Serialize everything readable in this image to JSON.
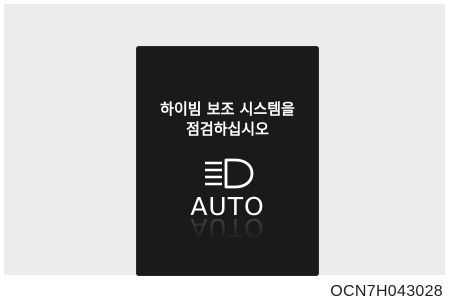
{
  "display": {
    "message_line1": "하이빔 보조 시스템을",
    "message_line2": "점검하십시오",
    "mode_label": "AUTO",
    "icon": "high-beam-headlamp-icon"
  },
  "figure_code": "OCN7H043028",
  "colors": {
    "frame_background": "#ececec",
    "display_background": "#1a1a1a",
    "text": "#ffffff",
    "code_text": "#222222"
  }
}
